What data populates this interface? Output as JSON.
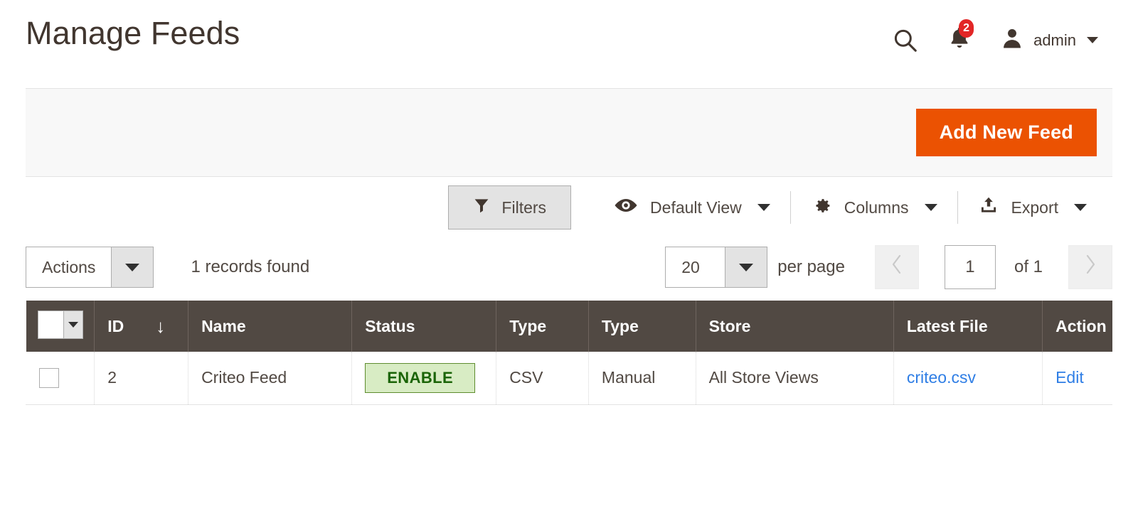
{
  "header": {
    "title": "Manage Feeds",
    "search_icon": "search-icon",
    "notifications": {
      "icon": "bell-icon",
      "count": "2",
      "badge_color": "#e22626"
    },
    "user": {
      "avatar_icon": "user-avatar-icon",
      "name": "admin",
      "caret_icon": "chevron-down-icon"
    }
  },
  "panel": {
    "add_new_feed_label": "Add New Feed",
    "primary_color": "#eb5202"
  },
  "toolbar": {
    "filters_label": "Filters",
    "filters_icon": "funnel-icon",
    "view_icon": "eye-icon",
    "view_label": "Default View",
    "columns_icon": "gear-icon",
    "columns_label": "Columns",
    "export_icon": "upload-icon",
    "export_label": "Export"
  },
  "grid_actions": {
    "actions_label": "Actions",
    "records_found": "1 records found"
  },
  "pager": {
    "per_page_value": "20",
    "per_page_label": "per page",
    "prev_icon": "chevron-left-icon",
    "next_icon": "chevron-right-icon",
    "current_page": "1",
    "of_label": "of 1"
  },
  "grid": {
    "select_all_icon": "select-all-checkbox-dropdown",
    "columns": [
      {
        "label": "ID",
        "sort": "↓"
      },
      {
        "label": "Name"
      },
      {
        "label": "Status"
      },
      {
        "label": "Type"
      },
      {
        "label": "Type"
      },
      {
        "label": "Store"
      },
      {
        "label": "Latest File"
      },
      {
        "label": "Action"
      }
    ],
    "header_bg": "#514943",
    "rows": [
      {
        "id": "2",
        "name": "Criteo Feed",
        "status": "ENABLE",
        "status_bg": "#d8ecc4",
        "status_color": "#1a6406",
        "type_format": "CSV",
        "type_mode": "Manual",
        "store": "All Store Views",
        "latest_file": "criteo.csv",
        "action": "Edit",
        "link_color": "#2f7ee5"
      }
    ]
  }
}
